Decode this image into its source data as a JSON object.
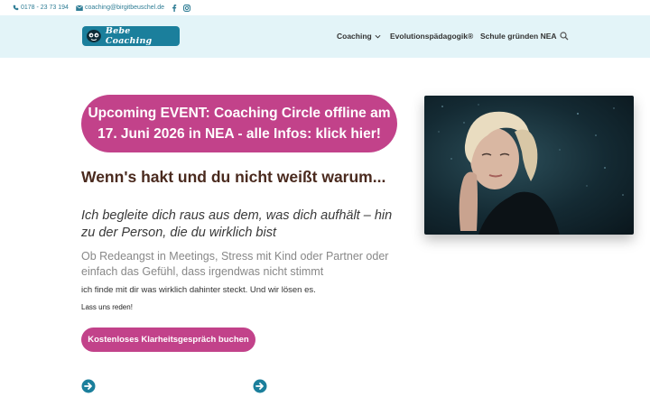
{
  "topbar": {
    "phone": "0178 - 23 73 194",
    "email": "coaching@birgitbeuschel.de",
    "icons": [
      "phone-icon",
      "mail-icon",
      "facebook-icon",
      "instagram-icon"
    ]
  },
  "header": {
    "logo_text": "Bebe Coaching",
    "nav": [
      {
        "label": "Coaching",
        "has_dropdown": true
      },
      {
        "label": "Evolutionspädagogik®",
        "has_dropdown": false
      },
      {
        "label": "Schule gründen NEA",
        "has_dropdown": false
      }
    ]
  },
  "main": {
    "event_button": "Upcoming EVENT: Coaching Circle offline am 17. Juni 2026 in NEA - alle Infos: klick hier!",
    "headline": "Wenn's hakt und du nicht weißt warum...",
    "subheadline": "Ich begleite dich raus aus dem, was dich aufhält – hin zu der Person, die du wirklich bist",
    "paragraph_1": "Ob Redeangst in Meetings, Stress mit Kind oder Partner oder einfach das Gefühl, dass irgendwas nicht stimmt",
    "paragraph_2": "ich finde mit dir was wirklich dahinter steckt. Und wir lösen es.",
    "paragraph_3": "Lass uns reden!",
    "cta_button": "Kostenloses Klarheitsgespräch buchen"
  },
  "colors": {
    "accent_magenta": "#c2428a",
    "brand_teal": "#1b7f9c",
    "header_bg": "#e3f4f8",
    "headline_brown": "#4a2a1e"
  }
}
